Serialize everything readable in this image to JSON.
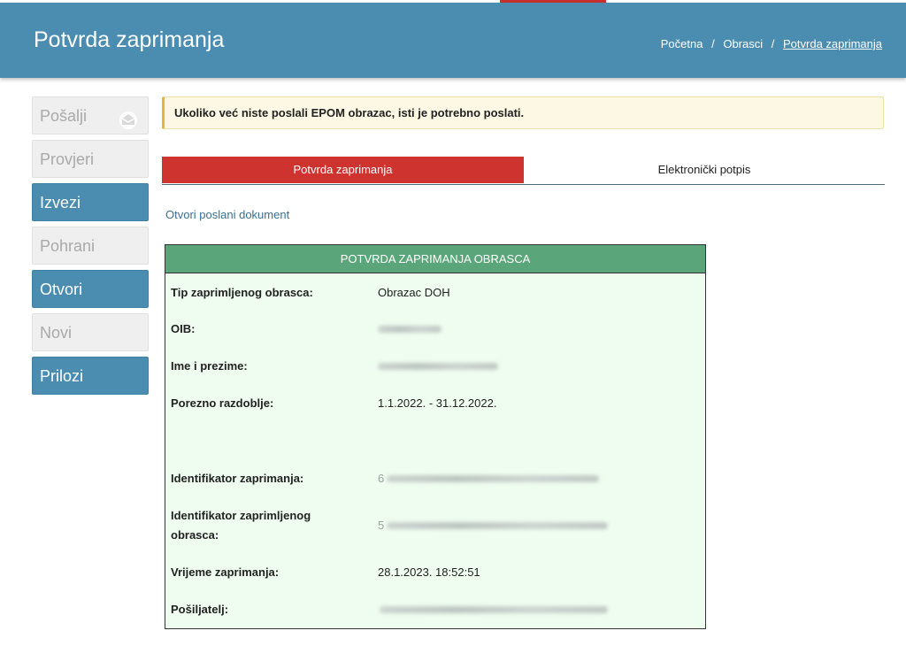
{
  "header": {
    "title": "Potvrda zaprimanja",
    "breadcrumb": [
      "Početna",
      "Obrasci",
      "Potvrda zaprimanja"
    ],
    "breadcrumb_separator": "/"
  },
  "sidebar": {
    "items": [
      {
        "label": "Pošalji",
        "state": "disabled",
        "icon": "send-mail-icon"
      },
      {
        "label": "Provjeri",
        "state": "disabled"
      },
      {
        "label": "Izvezi",
        "state": "active"
      },
      {
        "label": "Pohrani",
        "state": "disabled"
      },
      {
        "label": "Otvori",
        "state": "active"
      },
      {
        "label": "Novi",
        "state": "disabled"
      },
      {
        "label": "Prilozi",
        "state": "active"
      }
    ]
  },
  "alert": {
    "text": "Ukoliko već niste poslali EPOM obrazac, isti je potrebno poslati."
  },
  "tabs": [
    {
      "label": "Potvrda zaprimanja",
      "active": true
    },
    {
      "label": "Elektronički potpis",
      "active": false
    }
  ],
  "open_document_link": "Otvori poslani dokument",
  "receipt": {
    "heading": "POTVRDA ZAPRIMANJA OBRASCA",
    "rows": [
      {
        "label": "Tip zaprimljenog obrasca:",
        "value": "Obrazac DOH"
      },
      {
        "label": "OIB:",
        "value": "",
        "redacted": true
      },
      {
        "label": "Ime i prezime:",
        "value": "",
        "redacted": true
      },
      {
        "label": "Porezno razdoblje:",
        "value": "1.1.2022. - 31.12.2022."
      },
      {
        "label": "Identifikator zaprimanja:",
        "value": "6",
        "redacted": true
      },
      {
        "label": "Identifikator zaprimljenog",
        "label_line2": "obrasca:",
        "value": "5",
        "redacted": true
      },
      {
        "label": "Vrijeme zaprimanja:",
        "value": "28.1.2023. 18:52:51"
      },
      {
        "label": "Pošiljatelj:",
        "value": "",
        "redacted": true
      }
    ]
  },
  "colors": {
    "header_bg": "#4a8db1",
    "active_tab": "#cf3330",
    "panel_head": "#5aa67a",
    "panel_bg": "#effdf0",
    "alert_bg": "#fcf8e3"
  }
}
